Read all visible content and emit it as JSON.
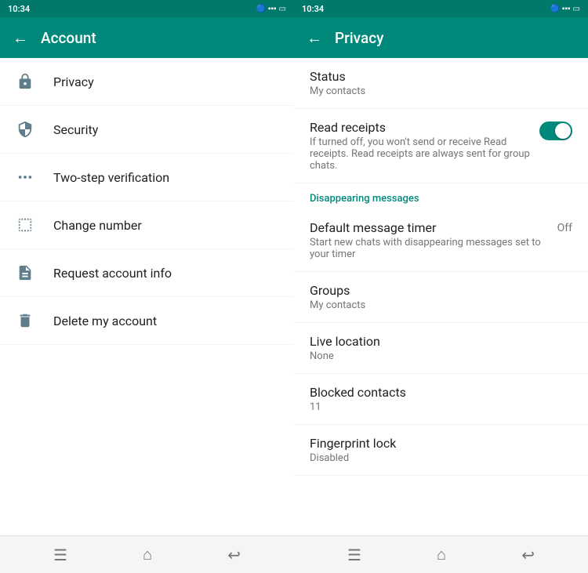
{
  "account_screen": {
    "status_bar": {
      "time": "10:34",
      "signal": "📶📶",
      "icons": "🔵"
    },
    "title": "Account",
    "back_label": "←",
    "menu_items": [
      {
        "id": "privacy",
        "label": "Privacy",
        "icon": "🔒"
      },
      {
        "id": "security",
        "label": "Security",
        "icon": "🛡"
      },
      {
        "id": "two-step",
        "label": "Two-step verification",
        "icon": "⬜"
      },
      {
        "id": "change-number",
        "label": "Change number",
        "icon": "📋"
      },
      {
        "id": "request-info",
        "label": "Request account info",
        "icon": "📄"
      },
      {
        "id": "delete-account",
        "label": "Delete my account",
        "icon": "🗑"
      }
    ],
    "nav": {
      "menu_icon": "☰",
      "home_icon": "⌂",
      "back_icon": "↩"
    }
  },
  "privacy_screen": {
    "status_bar": {
      "time": "10:34",
      "signal": "📶📶"
    },
    "title": "Privacy",
    "back_label": "←",
    "sections": [
      {
        "items": [
          {
            "id": "status",
            "label": "Status",
            "subtitle": "My contacts",
            "value": null,
            "toggle": null
          },
          {
            "id": "read-receipts",
            "label": "Read receipts",
            "subtitle": "If turned off, you won't send or receive Read receipts. Read receipts are always sent for group chats.",
            "value": null,
            "toggle": true
          }
        ]
      },
      {
        "section_label": "Disappearing messages",
        "items": [
          {
            "id": "default-timer",
            "label": "Default message timer",
            "subtitle": "Start new chats with disappearing messages set to your timer",
            "value": "Off",
            "toggle": null
          }
        ]
      },
      {
        "items": [
          {
            "id": "groups",
            "label": "Groups",
            "subtitle": "My contacts",
            "value": null,
            "toggle": null
          },
          {
            "id": "live-location",
            "label": "Live location",
            "subtitle": "None",
            "value": null,
            "toggle": null
          },
          {
            "id": "blocked-contacts",
            "label": "Blocked contacts",
            "subtitle": "11",
            "value": null,
            "toggle": null
          },
          {
            "id": "fingerprint-lock",
            "label": "Fingerprint lock",
            "subtitle": "Disabled",
            "value": null,
            "toggle": null
          }
        ]
      }
    ],
    "nav": {
      "menu_icon": "☰",
      "home_icon": "⌂",
      "back_icon": "↩"
    }
  }
}
